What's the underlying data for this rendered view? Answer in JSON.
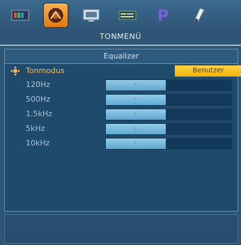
{
  "tabs": [
    {
      "name": "picture-icon"
    },
    {
      "name": "sound-icon",
      "active": true
    },
    {
      "name": "screen-icon"
    },
    {
      "name": "settings-icon"
    },
    {
      "name": "parental-icon"
    },
    {
      "name": "tools-icon"
    }
  ],
  "menu": {
    "title": "TONMENÜ",
    "submenu_title": "Equalizer"
  },
  "rows": [
    {
      "label": "Tonmodus",
      "value": "Benutzer"
    },
    {
      "label": "120Hz",
      "level": 0.48
    },
    {
      "label": "500Hz",
      "level": 0.48
    },
    {
      "label": "1.5kHz",
      "level": 0.48
    },
    {
      "label": "5kHz",
      "level": 0.48
    },
    {
      "label": "10kHz",
      "level": 0.48
    }
  ],
  "colors": {
    "accent": "#ffb64c",
    "selected_value_bg": "#f4b400",
    "slider_fill": "#7fbde0"
  }
}
